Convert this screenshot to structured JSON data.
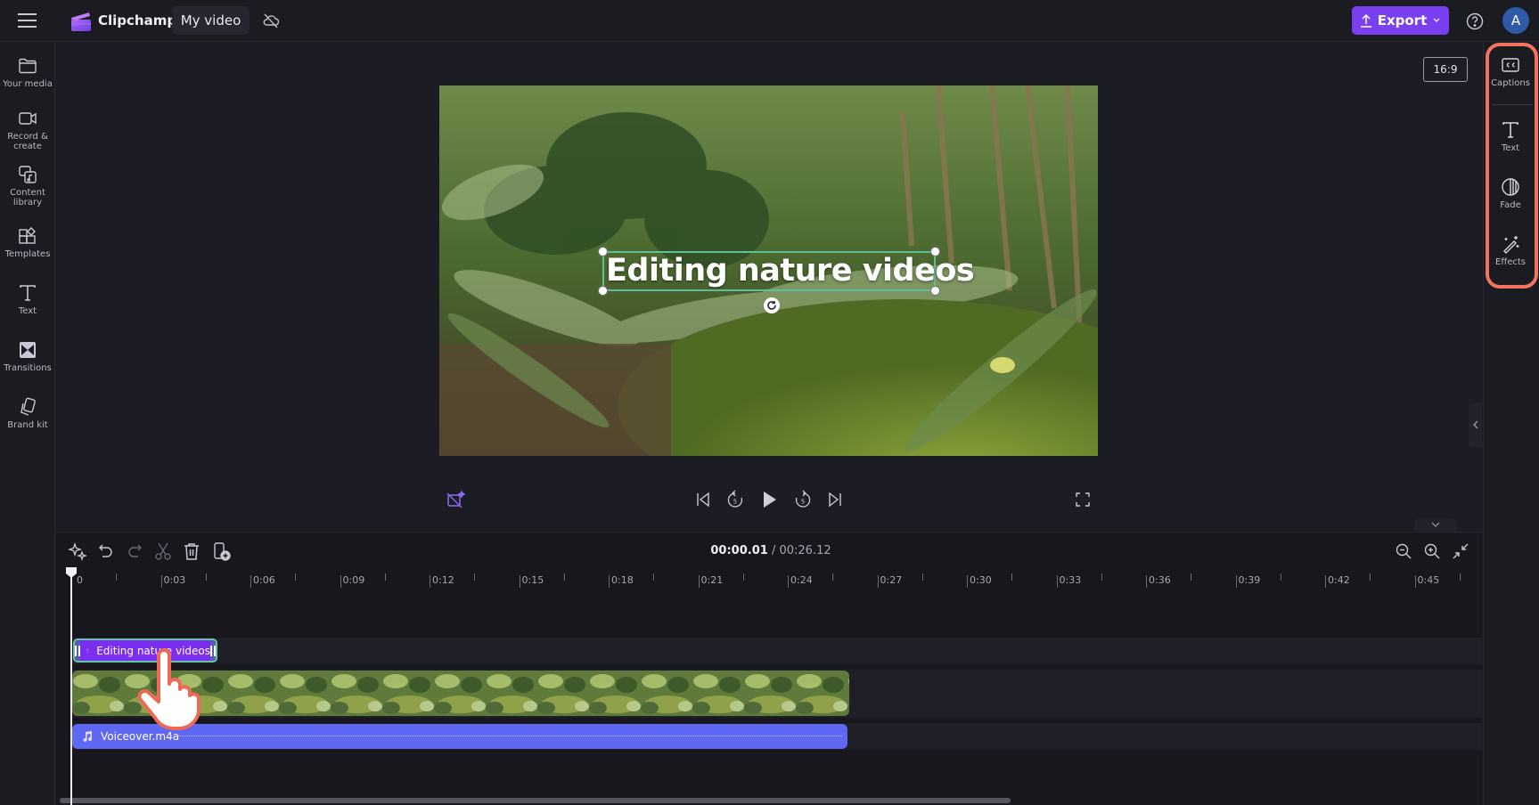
{
  "topbar": {
    "app_name": "Clipchamp",
    "project_title": "My video",
    "export_label": "Export",
    "avatar_initial": "A",
    "accent_color": "#7b3ff2"
  },
  "left_sidebar": {
    "items": [
      {
        "label": "Your media",
        "icon": "folder-icon"
      },
      {
        "label": "Record & create",
        "icon": "video-camera-icon"
      },
      {
        "label": "Content library",
        "icon": "content-library-icon"
      },
      {
        "label": "Templates",
        "icon": "templates-icon"
      },
      {
        "label": "Text",
        "icon": "text-icon"
      },
      {
        "label": "Transitions",
        "icon": "transitions-icon"
      },
      {
        "label": "Brand kit",
        "icon": "brand-kit-icon"
      }
    ]
  },
  "right_sidebar": {
    "items": [
      {
        "label": "Captions",
        "icon": "captions-icon"
      },
      {
        "label": "Text",
        "icon": "text-icon"
      },
      {
        "label": "Fade",
        "icon": "fade-icon"
      },
      {
        "label": "Effects",
        "icon": "effects-wand-icon"
      }
    ],
    "highlight_color": "#f2735f"
  },
  "preview": {
    "aspect_ratio": "16:9",
    "overlay_text": "Editing nature videos"
  },
  "timeline": {
    "current_time": "00:00.01",
    "separator": " / ",
    "total_time": "00:26.12",
    "ruler_labels": [
      "0",
      "0:03",
      "0:06",
      "0:09",
      "0:12",
      "0:15",
      "0:18",
      "0:21",
      "0:24",
      "0:27",
      "0:30",
      "0:33",
      "0:36",
      "0:39",
      "0:42",
      "0:45"
    ],
    "tracks": {
      "text_clip": "Editing nature videos",
      "audio_clip": "Voiceover.m4a"
    }
  }
}
